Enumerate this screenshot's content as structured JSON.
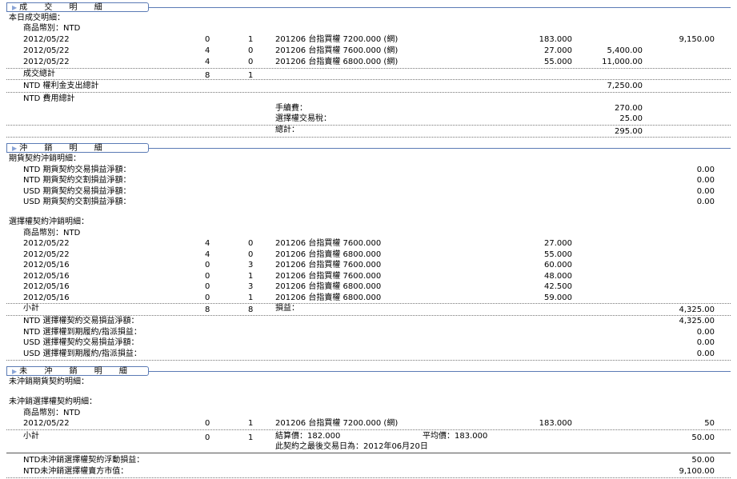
{
  "sections": {
    "trades": "成 交 明 細",
    "offset": "沖 銷 明 細",
    "open": "未 沖 銷 明 細"
  },
  "trades": {
    "title": "本日成交明細：",
    "currency": "商品幣別：NTD",
    "rows": [
      {
        "date": "2012/05/22",
        "a": "0",
        "b": "1",
        "desc": "201206 台指買權 7200.000 (網)",
        "price": "183.000",
        "c5": "",
        "c6": "9,150.00"
      },
      {
        "date": "2012/05/22",
        "a": "4",
        "b": "0",
        "desc": "201206 台指買權 7600.000 (網)",
        "price": "27.000",
        "c5": "5,400.00",
        "c6": ""
      },
      {
        "date": "2012/05/22",
        "a": "4",
        "b": "0",
        "desc": "201206 台指賣權 6800.000 (網)",
        "price": "55.000",
        "c5": "11,000.00",
        "c6": ""
      }
    ],
    "total_label": "成交總計",
    "total_a": "8",
    "total_b": "1",
    "premium_label": "NTD 權利金支出總計",
    "premium_value": "7,250.00",
    "fee_label": "NTD 費用總計",
    "commission_label": "手續費：",
    "commission_value": "270.00",
    "tax_label": "選擇權交易稅：",
    "tax_value": "25.00",
    "sum_label": "總計：",
    "sum_value": "295.00"
  },
  "offset": {
    "futures_title": "期貨契約沖銷明細：",
    "futures_lines": [
      {
        "label": "NTD 期貨契約交易損益淨額：",
        "value": "0.00"
      },
      {
        "label": "NTD 期貨契約交割損益淨額：",
        "value": "0.00"
      },
      {
        "label": "USD 期貨契約交易損益淨額：",
        "value": "0.00"
      },
      {
        "label": "USD 期貨契約交割損益淨額：",
        "value": "0.00"
      }
    ],
    "options_title": "選擇權契約沖銷明細：",
    "currency": "商品幣別：NTD",
    "rows": [
      {
        "date": "2012/05/22",
        "a": "4",
        "b": "0",
        "desc": "201206 台指買權 7600.000",
        "price": "27.000"
      },
      {
        "date": "2012/05/22",
        "a": "4",
        "b": "0",
        "desc": "201206 台指賣權 6800.000",
        "price": "55.000"
      },
      {
        "date": "2012/05/16",
        "a": "0",
        "b": "3",
        "desc": "201206 台指買權 7600.000",
        "price": "60.000"
      },
      {
        "date": "2012/05/16",
        "a": "0",
        "b": "1",
        "desc": "201206 台指買權 7600.000",
        "price": "48.000"
      },
      {
        "date": "2012/05/16",
        "a": "0",
        "b": "3",
        "desc": "201206 台指賣權 6800.000",
        "price": "42.500"
      },
      {
        "date": "2012/05/16",
        "a": "0",
        "b": "1",
        "desc": "201206 台指賣權 6800.000",
        "price": "59.000"
      }
    ],
    "subtotal_label": "小計",
    "subtotal_a": "8",
    "subtotal_b": "8",
    "pl_label": "損益：",
    "pl_value": "4,325.00",
    "option_lines": [
      {
        "label": "NTD 選擇權契約交易損益淨額：",
        "value": "4,325.00"
      },
      {
        "label": "NTD 選擇權到期履約/指派損益：",
        "value": "0.00"
      },
      {
        "label": "USD 選擇權契約交易損益淨額：",
        "value": "0.00"
      },
      {
        "label": "USD 選擇權到期履約/指派損益：",
        "value": "0.00"
      }
    ]
  },
  "open": {
    "futures_title": "未沖銷期貨契約明細：",
    "options_title": "未沖銷選擇權契約明細：",
    "currency": "商品幣別：NTD",
    "row": {
      "date": "2012/05/22",
      "a": "0",
      "b": "1",
      "desc": "201206 台指買權 7200.000 (網)",
      "price": "183.000",
      "value": "50"
    },
    "subtotal_label": "小計",
    "subtotal_a": "0",
    "subtotal_b": "1",
    "settle_label": "結算價：182.000",
    "avg_label": "平均價：183.000",
    "subtotal_value": "50.00",
    "last_trade": "此契約之最後交易日為：2012年06月20日",
    "float_label": "NTD未沖銷選擇權契約浮動損益：",
    "float_value": "50.00",
    "market_label": "NTD未沖銷選擇權賣方市值：",
    "market_value": "9,100.00"
  }
}
